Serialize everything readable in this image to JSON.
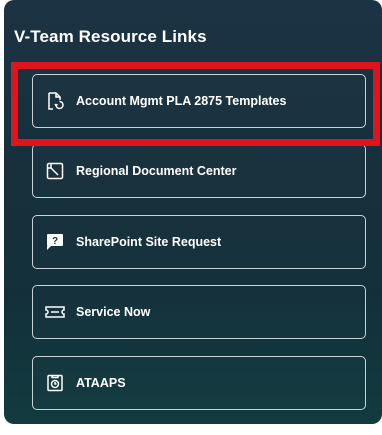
{
  "header": {
    "title": "V-Team Resource Links"
  },
  "links": [
    {
      "label": "Account Mgmt PLA 2875 Templates",
      "icon": "document-refresh-icon"
    },
    {
      "label": "Regional Document Center",
      "icon": "document-icon"
    },
    {
      "label": "SharePoint Site Request",
      "icon": "question-badge-icon"
    },
    {
      "label": "Service Now",
      "icon": "ticket-icon"
    },
    {
      "label": "ATAAPS",
      "icon": "clock-form-icon"
    }
  ],
  "annotation": {
    "highlight_color": "#e0141c",
    "highlighted_item": "Account Mgmt PLA 2875 Templates"
  },
  "colors": {
    "panel": "#17303c",
    "text": "#ffffff",
    "border": "#c9d2d6"
  }
}
